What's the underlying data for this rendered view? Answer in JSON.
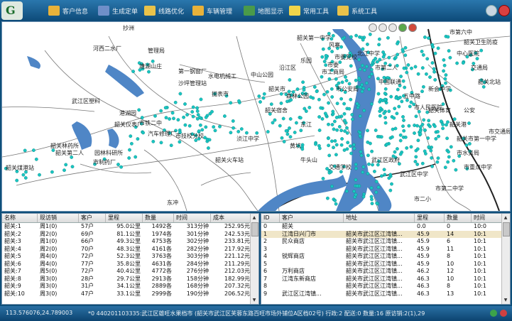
{
  "toolbar": {
    "logo_letter": "G",
    "buttons": [
      {
        "label": "客户信息",
        "icon": "envelope-icon",
        "color": "#e8b23a"
      },
      {
        "label": "生成定单",
        "icon": "grid-icon",
        "color": "#6f8fc9"
      },
      {
        "label": "线路优化",
        "icon": "folder-icon",
        "color": "#e9c24a"
      },
      {
        "label": "车辆管理",
        "icon": "envelope-icon",
        "color": "#e8b23a"
      },
      {
        "label": "地图显示",
        "icon": "book-icon",
        "color": "#4a9a4a"
      },
      {
        "label": "常用工具",
        "icon": "note-icon",
        "color": "#f1d54a"
      },
      {
        "label": "系统工具",
        "icon": "gear-folder-icon",
        "color": "#e9c24a"
      }
    ],
    "window_controls": [
      {
        "icon": "minimize-icon",
        "color": "#c9d6e2"
      },
      {
        "icon": "close-icon",
        "color": "#d94040"
      }
    ]
  },
  "map": {
    "labels": [
      "抄洲",
      "河西二水厂",
      "管理局",
      "塘湖山庄",
      "第一钢窗厂",
      "水电机械工",
      "沙坪管理站",
      "抛表市",
      "武江区塑料",
      "港湖园",
      "韶关仪表厂",
      "市铁二中",
      "汽车修理厂",
      "市技校分校",
      "韶关林药所",
      "韶关第二人",
      "园林科研所",
      "韶关煤港站",
      "东冲",
      "市制药厂",
      "韶关第一中学",
      "风寨",
      "乐园",
      "市委党校",
      "市委",
      "市工商局",
      "北江中学",
      "市第二人",
      "中国联通",
      "市公安局",
      "五中路",
      "市人民医院",
      "韶关体育",
      "韶关港",
      "公安",
      "韶关市第一中学",
      "市水务局",
      "市重点中学",
      "市交通局",
      "市第二中学",
      "市二小",
      "武江区中学",
      "牛头山",
      "交通学校",
      "黄坑",
      "武江区政府",
      "市第六中",
      "韶关卫生防疫",
      "中心医院",
      "交通局",
      "韶关北站",
      "韶关火车站",
      "浈江中学",
      "韶关宿舍",
      "森林公园",
      "韶关市",
      "中山公园",
      "沿江区",
      "东江",
      "新会中学"
    ],
    "zoom_controls": [
      "zoom-in-icon",
      "zoom-out-icon",
      "pan-icon",
      "refresh-icon",
      "layer-icon"
    ]
  },
  "route_table": {
    "columns": [
      "名称",
      "现访销",
      "客户",
      "里程",
      "数量",
      "时间",
      "成本"
    ],
    "rows": [
      [
        "韶关:1",
        "周1(0)",
        "57户",
        "95.0公里",
        "1492各",
        "313分钟",
        "252.95元"
      ],
      [
        "韶关:2",
        "周2(0)",
        "69户",
        "81.1公里",
        "1974各",
        "301分钟",
        "242.53元"
      ],
      [
        "韶关:3",
        "周1(0)",
        "66户",
        "49.3公里",
        "4753各",
        "302分钟",
        "233.81元"
      ],
      [
        "韶关:4",
        "周2(0)",
        "70户",
        "48.3公里",
        "4161各",
        "282分钟",
        "217.92元"
      ],
      [
        "韶关:5",
        "周4(0)",
        "72户",
        "52.3公里",
        "3763各",
        "303分钟",
        "221.12元"
      ],
      [
        "韶关:6",
        "周4(0)",
        "77户",
        "35.8公里",
        "4631各",
        "284分钟",
        "211.29元"
      ],
      [
        "韶关:7",
        "周5(0)",
        "72户",
        "40.4公里",
        "4772各",
        "276分钟",
        "212.03元"
      ],
      [
        "韶关:8",
        "周3(0)",
        "28户",
        "29.7公里",
        "2913各",
        "158分钟",
        "182.99元"
      ],
      [
        "韶关:9",
        "周3(0)",
        "31户",
        "34.1公里",
        "2889各",
        "168分钟",
        "207.32元"
      ],
      [
        "韶关:10",
        "周3(0)",
        "47户",
        "33.1公里",
        "2999各",
        "190分钟",
        "206.52元"
      ]
    ]
  },
  "customer_table": {
    "columns": [
      "ID",
      "客户",
      "地址",
      "里程",
      "数量",
      "时间"
    ],
    "rows": [
      [
        "0",
        "韶关",
        "",
        "0.0",
        "0",
        "10:0"
      ],
      [
        "1",
        "江湾日兴门市",
        "韶关市武江区江湾镇...",
        "45.9",
        "14",
        "10:1"
      ],
      [
        "2",
        "民众商店",
        "韶关市武江区江湾镇...",
        "45.9",
        "6",
        "10:1"
      ],
      [
        "3",
        "",
        "韶关市武江区江湾镇...",
        "45.9",
        "11",
        "10:1"
      ],
      [
        "4",
        "锐辉商店",
        "韶关市武江区江湾镇...",
        "45.9",
        "8",
        "10:1"
      ],
      [
        "5",
        "",
        "韶关市武江区江湾镇...",
        "45.9",
        "10",
        "10:1"
      ],
      [
        "6",
        "万利商店",
        "韶关市武江区江湾镇...",
        "46.2",
        "12",
        "10:1"
      ],
      [
        "7",
        "江湾东新商店",
        "韶关市武江区江湾镇...",
        "46.3",
        "10",
        "10:1"
      ],
      [
        "8",
        "",
        "韶关市武江区江湾镇...",
        "46.3",
        "8",
        "10:1"
      ],
      [
        "9",
        "武江区江湾镇...",
        "韶关市武江区江湾镇...",
        "46.3",
        "13",
        "10:1"
      ]
    ]
  },
  "status": {
    "coords": "113.576076,24.789003",
    "info": "*0 440201103335:武江区雄旺水果档市 (韶关市武江区芙蓉东路百旺市场外铺位A区档02号) 行政:2 配送:0 数量:16 原访销:2(1),29"
  },
  "colors": {
    "toolbar_bg": "#0d4a78",
    "river": "#4f86c6",
    "marker": "#19c6c2",
    "road": "#777777"
  }
}
